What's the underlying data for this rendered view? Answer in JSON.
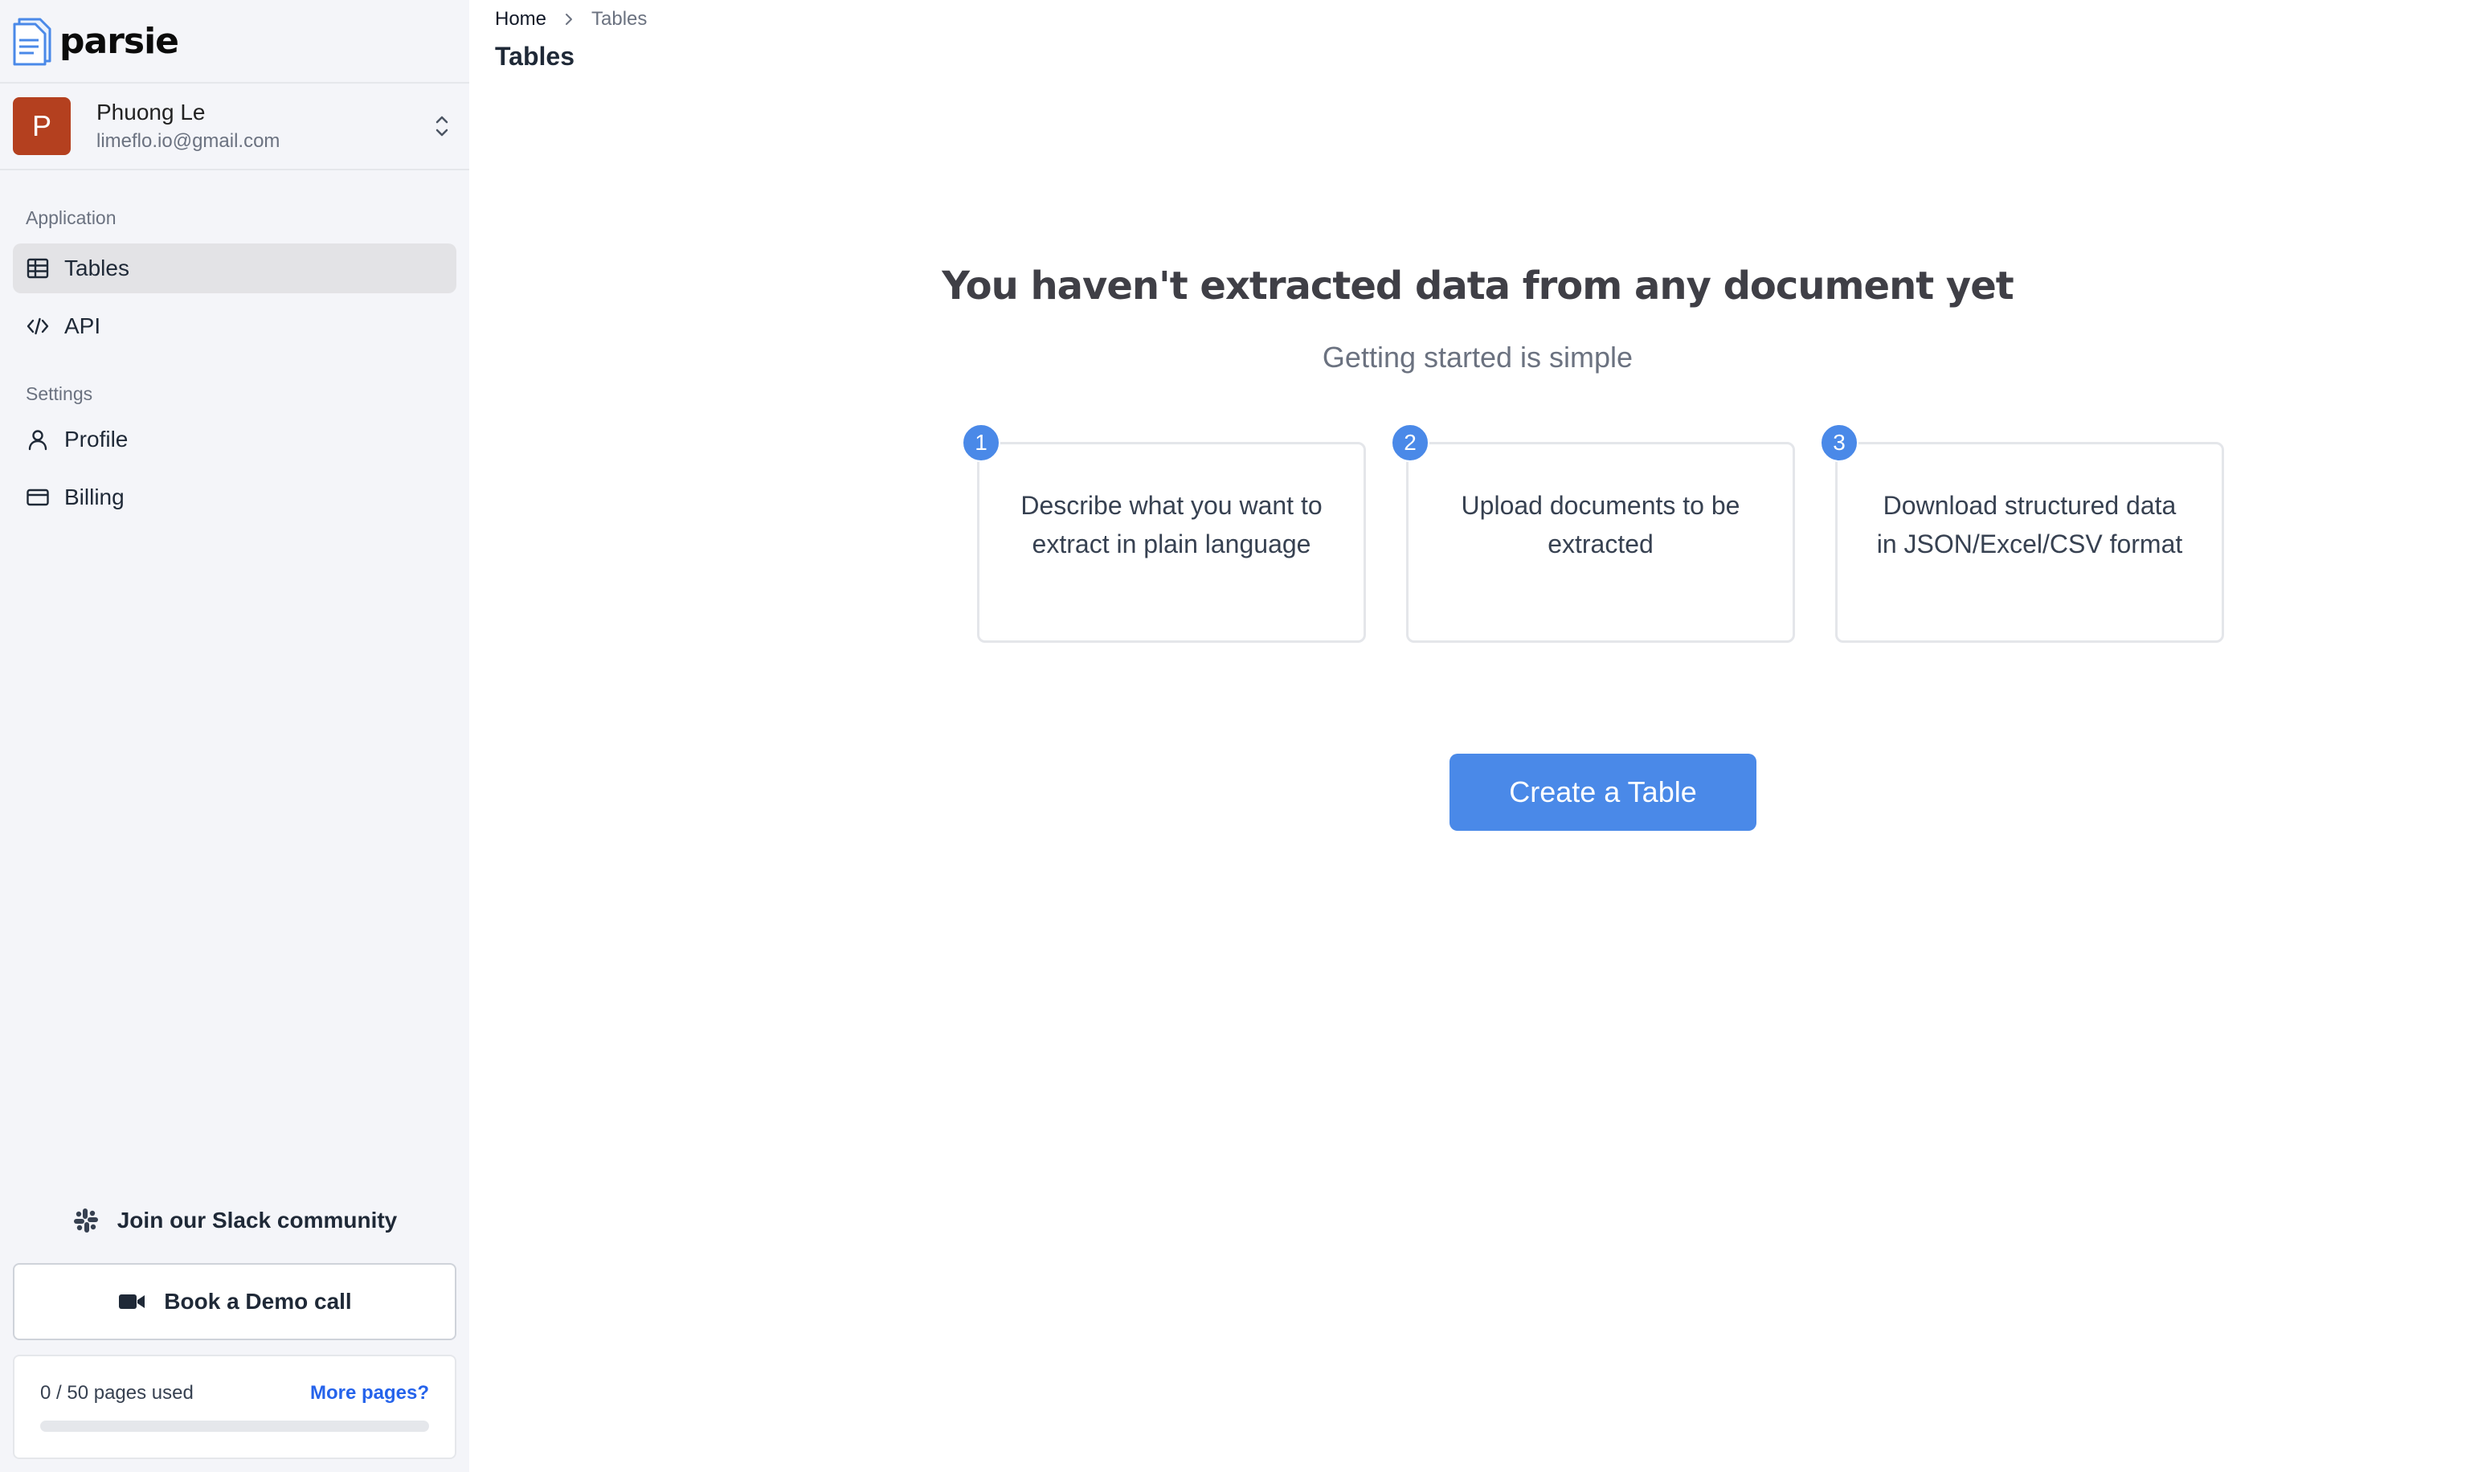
{
  "brand": {
    "name": "parsie"
  },
  "user": {
    "initial": "P",
    "name": "Phuong Le",
    "email": "limeflo.io@gmail.com"
  },
  "sidebar": {
    "application_label": "Application",
    "application_items": [
      {
        "label": "Tables",
        "icon": "table-icon",
        "active": true
      },
      {
        "label": "API",
        "icon": "code-icon",
        "active": false
      }
    ],
    "settings_label": "Settings",
    "settings_items": [
      {
        "label": "Profile",
        "icon": "user-icon"
      },
      {
        "label": "Billing",
        "icon": "credit-card-icon"
      }
    ],
    "slack_label": "Join our Slack community",
    "demo_label": "Book a Demo call",
    "usage": {
      "text": "0 / 50 pages used",
      "used": 0,
      "total": 50,
      "more_label": "More pages?"
    }
  },
  "breadcrumb": {
    "home": "Home",
    "current": "Tables"
  },
  "page": {
    "title": "Tables"
  },
  "empty_state": {
    "heading": "You haven't extracted data from any document yet",
    "subheading": "Getting started is simple",
    "steps": [
      {
        "number": "1",
        "text": "Describe what you want to extract in plain language"
      },
      {
        "number": "2",
        "text": "Upload documents to be extracted"
      },
      {
        "number": "3",
        "text": "Download structured data in JSON/Excel/CSV format"
      }
    ],
    "cta_label": "Create a Table"
  },
  "colors": {
    "accent": "#4a89e8",
    "avatar": "#b4401f",
    "link": "#2563eb"
  }
}
